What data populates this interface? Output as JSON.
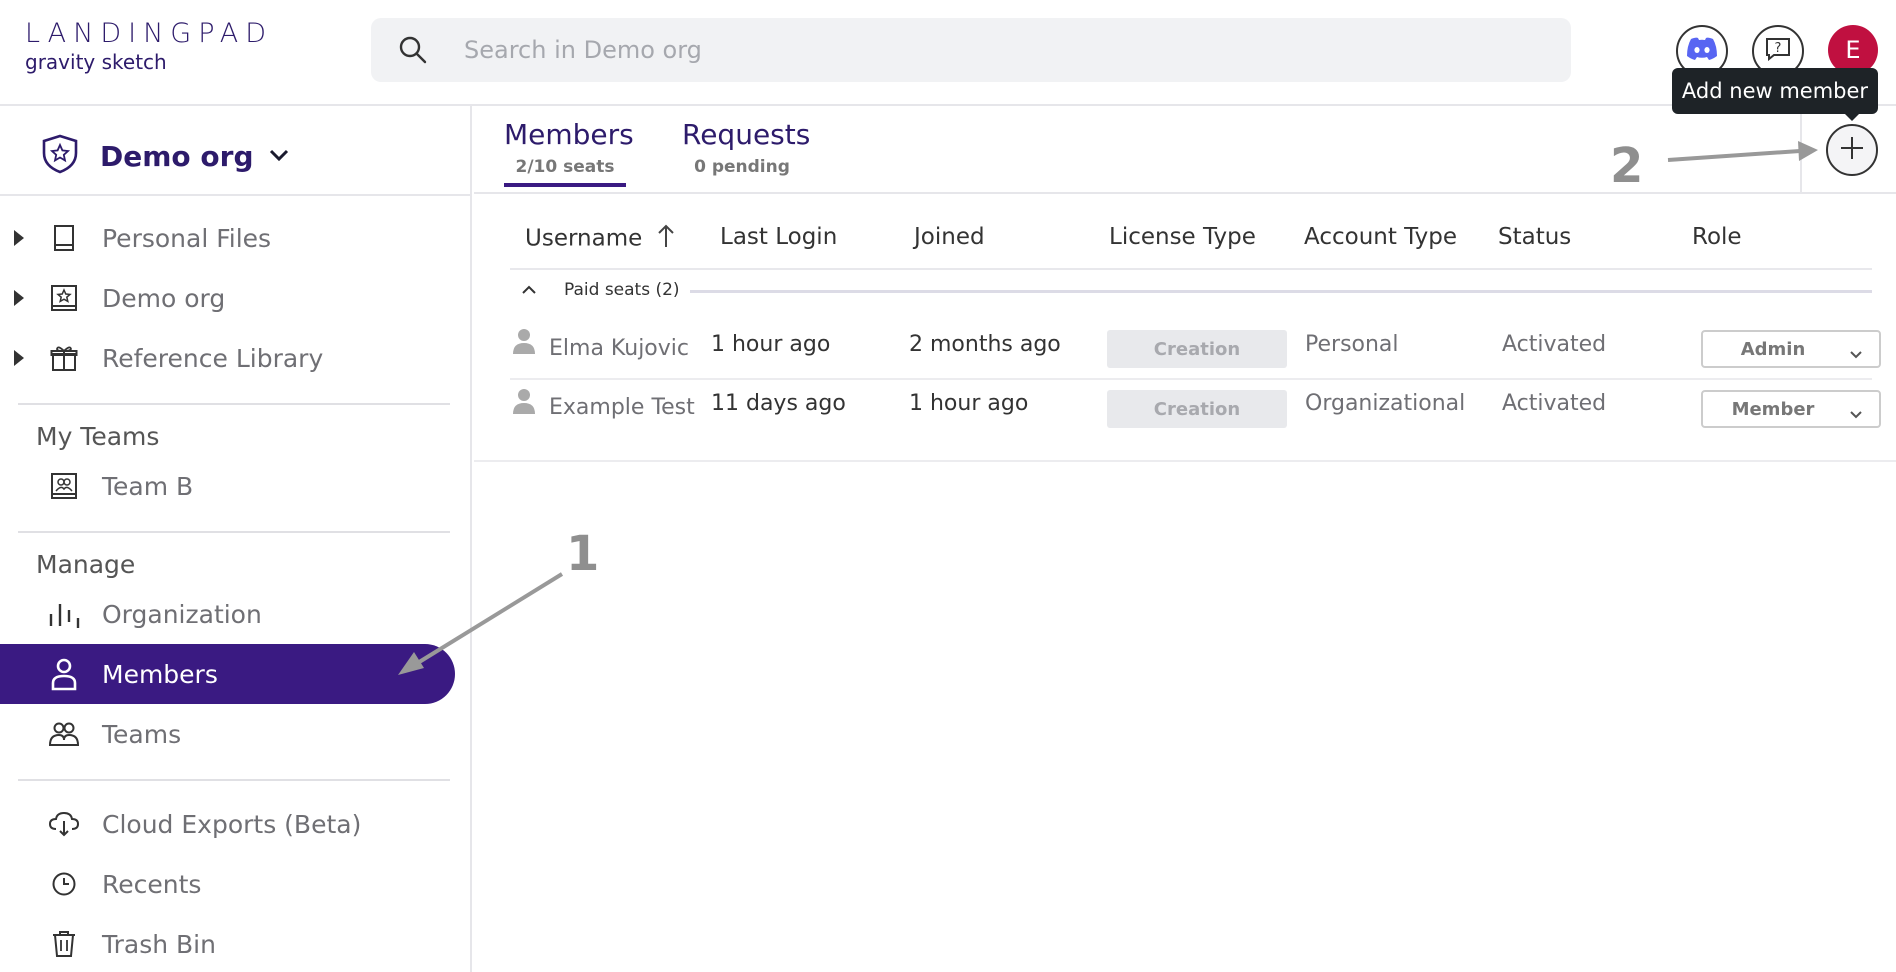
{
  "header": {
    "logo_top": "LANDINGPAD",
    "logo_bottom": "gravity sketch",
    "search_placeholder": "Search in Demo org",
    "avatar_initial": "E",
    "tooltip": "Add new member"
  },
  "sidebar": {
    "org_name": "Demo org",
    "files": [
      {
        "label": "Personal Files",
        "icon": "book-icon"
      },
      {
        "label": "Demo org",
        "icon": "star-frame-icon"
      },
      {
        "label": "Reference Library",
        "icon": "gift-icon"
      }
    ],
    "my_teams_label": "My Teams",
    "teams": [
      {
        "label": "Team B",
        "icon": "team-frame-icon"
      }
    ],
    "manage_label": "Manage",
    "manage_items": [
      {
        "label": "Organization",
        "icon": "bars-icon"
      },
      {
        "label": "Members",
        "icon": "user-icon",
        "active": true
      },
      {
        "label": "Teams",
        "icon": "users-icon"
      }
    ],
    "bottom_items": [
      {
        "label": "Cloud Exports (Beta)",
        "icon": "cloud-download-icon"
      },
      {
        "label": "Recents",
        "icon": "clock-icon"
      },
      {
        "label": "Trash Bin",
        "icon": "trash-icon"
      }
    ]
  },
  "tabs": [
    {
      "title": "Members",
      "sub": "2/10 seats",
      "active": true
    },
    {
      "title": "Requests",
      "sub": "0 pending",
      "active": false
    }
  ],
  "table": {
    "columns": [
      "Username",
      "Last Login",
      "Joined",
      "License Type",
      "Account Type",
      "Status",
      "Role"
    ],
    "group_label": "Paid seats (2)",
    "rows": [
      {
        "username": "Elma Kujovic",
        "last_login": "1 hour ago",
        "joined": "2 months ago",
        "license": "Creation",
        "account": "Personal",
        "status": "Activated",
        "role": "Admin"
      },
      {
        "username": "Example Test",
        "last_login": "11 days ago",
        "joined": "1 hour ago",
        "license": "Creation",
        "account": "Organizational",
        "status": "Activated",
        "role": "Member"
      }
    ]
  },
  "annotations": {
    "one": "1",
    "two": "2"
  },
  "colors": {
    "accent": "#3a1a82",
    "brand": "#2d1b6b",
    "avatar": "#c01040"
  }
}
